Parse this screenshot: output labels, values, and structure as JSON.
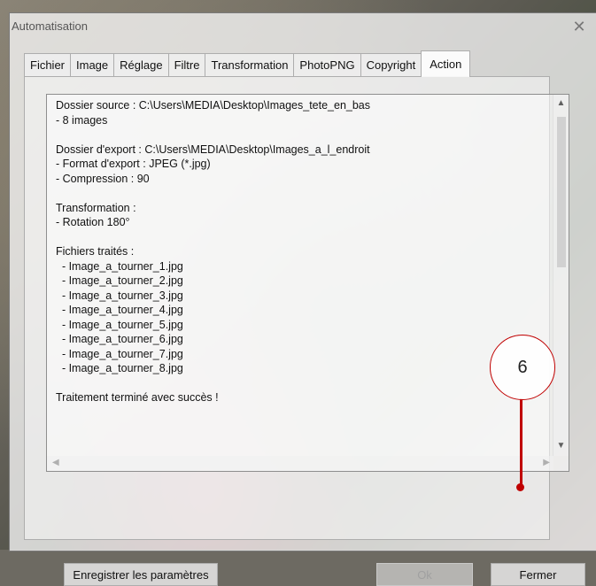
{
  "window": {
    "title": "Automatisation",
    "close_glyph": "✕"
  },
  "tabs": [
    {
      "label": "Fichier",
      "active": false
    },
    {
      "label": "Image",
      "active": false
    },
    {
      "label": "Réglage",
      "active": false
    },
    {
      "label": "Filtre",
      "active": false
    },
    {
      "label": "Transformation",
      "active": false
    },
    {
      "label": "PhotoPNG",
      "active": false
    },
    {
      "label": "Copyright",
      "active": false
    },
    {
      "label": "Action",
      "active": true
    }
  ],
  "log": {
    "lines": [
      "Dossier source : C:\\Users\\MEDIA\\Desktop\\Images_tete_en_bas",
      "- 8 images",
      "",
      "Dossier d'export : C:\\Users\\MEDIA\\Desktop\\Images_a_l_endroit",
      "- Format d'export : JPEG (*.jpg)",
      "- Compression : 90",
      "",
      "Transformation :",
      "- Rotation 180°",
      "",
      "Fichiers traités :",
      "  - Image_a_tourner_1.jpg",
      "  - Image_a_tourner_2.jpg",
      "  - Image_a_tourner_3.jpg",
      "  - Image_a_tourner_4.jpg",
      "  - Image_a_tourner_5.jpg",
      "  - Image_a_tourner_6.jpg",
      "  - Image_a_tourner_7.jpg",
      "  - Image_a_tourner_8.jpg",
      "",
      "Traitement terminé avec succès !"
    ]
  },
  "scrollbars": {
    "up": "▲",
    "down": "▼",
    "left": "◀",
    "right": "▶"
  },
  "buttons": {
    "save_label": "Enregistrer les paramètres",
    "ok_label": "Ok",
    "close_label": "Fermer"
  },
  "callout": {
    "number": "6",
    "color": "#c00000"
  }
}
